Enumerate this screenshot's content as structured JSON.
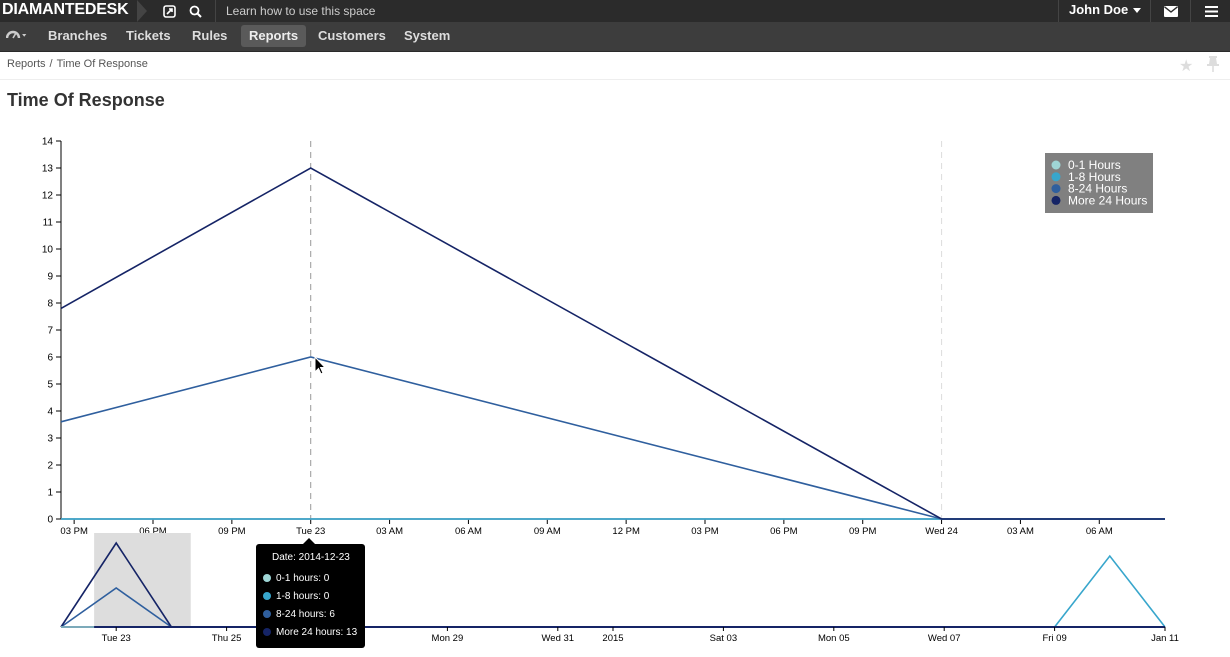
{
  "app": {
    "brand": "DIAMANTEDESK",
    "hint": "Learn how to use this space",
    "user_name": "John Doe"
  },
  "nav": {
    "items": [
      {
        "label": "Branches",
        "active": false
      },
      {
        "label": "Tickets",
        "active": false
      },
      {
        "label": "Rules",
        "active": false
      },
      {
        "label": "Reports",
        "active": true
      },
      {
        "label": "Customers",
        "active": false
      },
      {
        "label": "System",
        "active": false
      }
    ]
  },
  "breadcrumb": [
    "Reports",
    "Time Of Response"
  ],
  "breadcrumb_separator": "/",
  "page": {
    "title": "Time Of Response"
  },
  "tooltip": {
    "title": "Date: 2014-12-23",
    "rows": [
      "0-1 hours: 0",
      "1-8 hours: 0",
      "8-24 hours: 6",
      "More 24 hours: 13"
    ]
  },
  "chart_data": {
    "type": "line",
    "ylim": [
      0,
      14
    ],
    "yticks": [
      0,
      1,
      2,
      3,
      4,
      5,
      6,
      7,
      8,
      9,
      10,
      11,
      12,
      13,
      14
    ],
    "x_tick_labels": [
      "03 PM",
      "06 PM",
      "09 PM",
      "Tue 23",
      "03 AM",
      "06 AM",
      "09 AM",
      "12 PM",
      "03 PM",
      "06 PM",
      "09 PM",
      "Wed 24",
      "03 AM",
      "06 AM"
    ],
    "x_hours": [
      0,
      3,
      6,
      9,
      12,
      15,
      18,
      21,
      24,
      27,
      30,
      33,
      36,
      39
    ],
    "xlim_hours": [
      -0.5,
      41.5
    ],
    "series": [
      {
        "name": "0-1 Hours",
        "color": "#9fd6d6",
        "points": [
          [
            -0.5,
            0
          ],
          [
            9,
            0
          ],
          [
            33,
            0
          ],
          [
            41.5,
            0
          ]
        ]
      },
      {
        "name": "1-8 Hours",
        "color": "#38a6cc",
        "points": [
          [
            -0.5,
            0
          ],
          [
            9,
            0
          ],
          [
            33,
            0
          ],
          [
            41.5,
            0
          ]
        ]
      },
      {
        "name": "8-24 Hours",
        "color": "#2f5f9e",
        "points": [
          [
            -0.5,
            3.6
          ],
          [
            9,
            6
          ],
          [
            33,
            0
          ],
          [
            41.5,
            0
          ]
        ]
      },
      {
        "name": "More 24 Hours",
        "color": "#152466",
        "points": [
          [
            -0.5,
            7.8
          ],
          [
            9,
            13
          ],
          [
            33,
            0
          ],
          [
            41.5,
            0
          ]
        ]
      }
    ],
    "context": {
      "x_tick_labels": [
        "Tue 23",
        "Thu 25",
        "Mon 29",
        "Wed 31",
        "2015",
        "Sat 03",
        "Mon 05",
        "Wed 07",
        "Fri 09",
        "Jan 11"
      ],
      "x_days": [
        1,
        3,
        7,
        9,
        10,
        12,
        14,
        16,
        18,
        20
      ],
      "xlim_days": [
        0,
        20
      ]
    }
  },
  "colors": {
    "topbar": "#2b2b2b",
    "navbar": "#3d3d3d",
    "legend_bg": "#808080"
  }
}
